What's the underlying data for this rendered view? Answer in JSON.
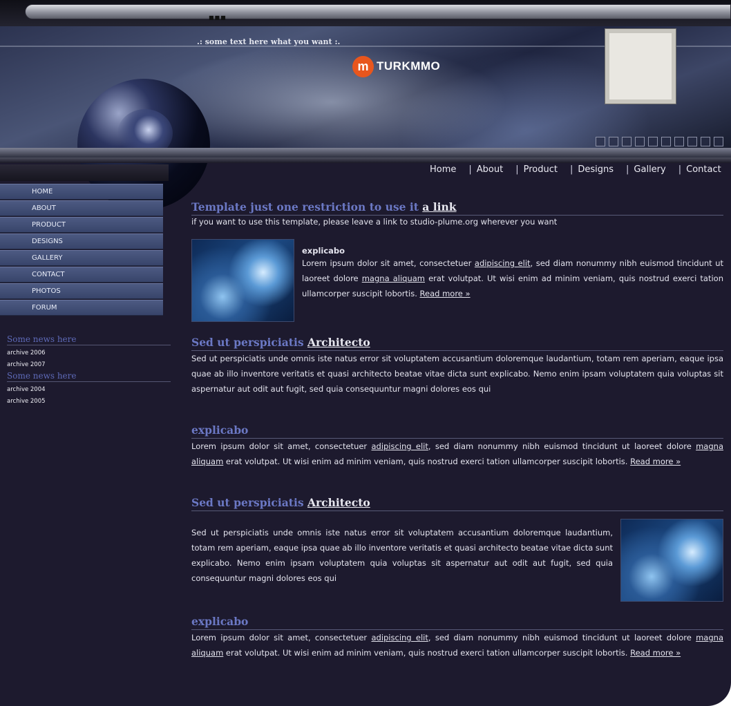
{
  "banner": {
    "tagline": ".: some text here what you want :.",
    "logo_text": "TURKMMO",
    "logo_mark": "m"
  },
  "topnav": {
    "items": [
      "Home",
      "About",
      "Product",
      "Designs",
      "Gallery",
      "Contact"
    ],
    "separator": "|"
  },
  "sidebar": {
    "items": [
      "HOME",
      "ABOUT",
      "PRODUCT",
      "DESIGNS",
      "GALLERY",
      "CONTACT",
      "PHOTOS",
      "FORUM"
    ],
    "news": [
      {
        "title": "Some news here",
        "archives": [
          "archive 2006",
          "archive 2007"
        ]
      },
      {
        "title": "Some news here",
        "archives": [
          "archive 2004",
          "archive 2005"
        ]
      }
    ]
  },
  "content": {
    "s1": {
      "heading": "Template just one restriction to use it",
      "heading_link": "a link",
      "text": "if you want to use this template, please leave a link to studio-plume.org wherever you want"
    },
    "s2": {
      "subtitle": "explicabo",
      "t1": "Lorem ipsum dolor sit amet, consectetuer ",
      "l1": "adipiscing elit",
      "t2": ", sed diam nonummy nibh euismod tincidunt ut laoreet dolore ",
      "l2": "magna aliquam",
      "t3": " erat volutpat. Ut wisi enim ad minim veniam, quis nostrud exerci tation ullamcorper suscipit lobortis. ",
      "more": "Read more »"
    },
    "s3": {
      "heading": "Sed ut perspiciatis",
      "heading_link": "Architecto",
      "text": "Sed ut perspiciatis unde omnis iste natus error sit voluptatem accusantium doloremque laudantium, totam rem aperiam, eaque ipsa quae ab illo inventore veritatis et quasi architecto beatae vitae dicta sunt explicabo. Nemo enim ipsam voluptatem quia voluptas sit aspernatur aut odit aut fugit, sed quia consequuntur magni dolores eos qui"
    },
    "s4": {
      "heading": "explicabo",
      "t1": "Lorem ipsum dolor sit amet, consectetuer ",
      "l1": "adipiscing elit",
      "t2": ", sed diam nonummy nibh euismod tincidunt ut laoreet dolore ",
      "l2": "magna aliquam",
      "t3": " erat volutpat. Ut wisi enim ad minim veniam, quis nostrud exerci tation ullamcorper suscipit lobortis. ",
      "more": "Read more »"
    },
    "s5": {
      "heading": "Sed ut perspiciatis",
      "heading_link": "Architecto",
      "text": "Sed ut perspiciatis unde omnis iste natus error sit voluptatem accusantium doloremque laudantium, totam rem aperiam, eaque ipsa quae ab illo inventore veritatis et quasi architecto beatae vitae dicta sunt explicabo. Nemo enim ipsam voluptatem quia voluptas sit aspernatur aut odit aut fugit, sed quia consequuntur magni dolores eos qui"
    },
    "s6": {
      "heading": "explicabo",
      "t1": "Lorem ipsum dolor sit amet, consectetuer ",
      "l1": "adipiscing elit",
      "t2": ", sed diam nonummy nibh euismod tincidunt ut laoreet dolore ",
      "l2": "magna aliquam",
      "t3": " erat volutpat. Ut wisi enim ad minim veniam, quis nostrud exerci tation ullamcorper suscipit lobortis. ",
      "more": "Read more »"
    }
  }
}
